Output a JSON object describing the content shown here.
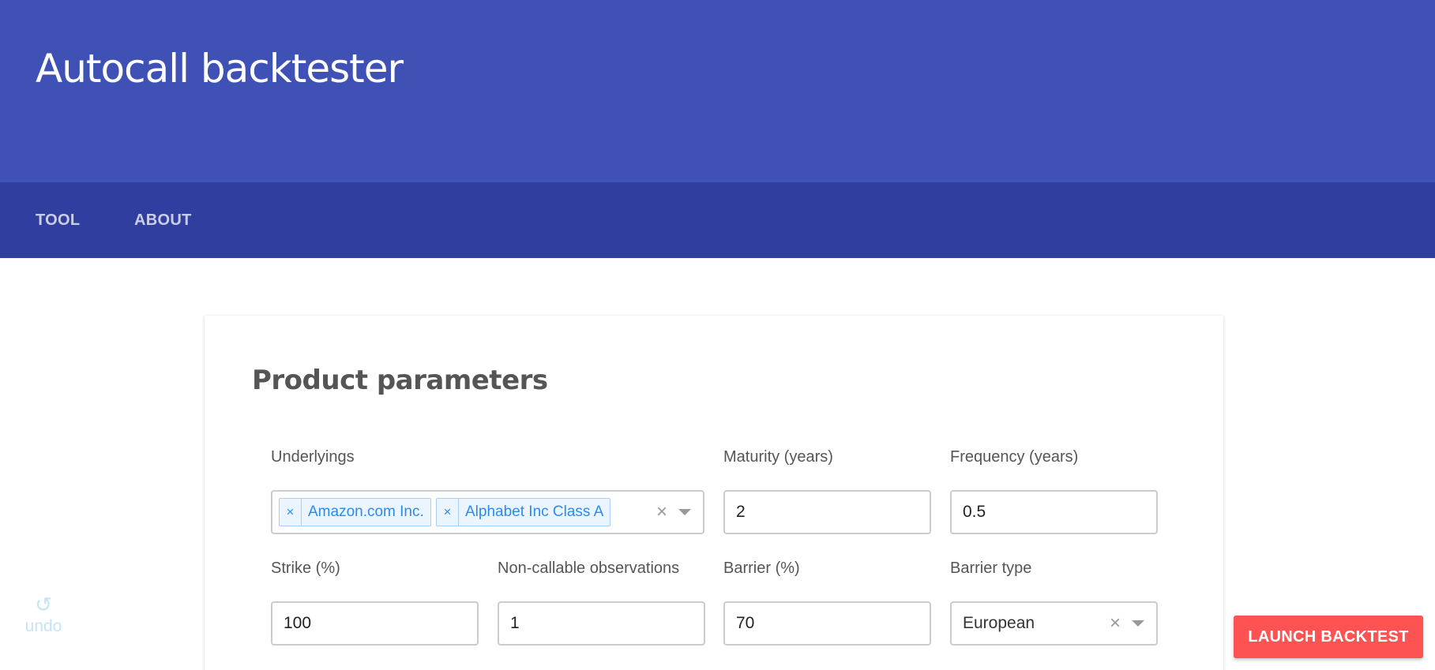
{
  "app": {
    "title": "Autocall backtester"
  },
  "tabs": [
    {
      "label": "TOOL"
    },
    {
      "label": "ABOUT"
    }
  ],
  "card": {
    "title": "Product parameters",
    "fields": {
      "underlyings": {
        "label": "Underlyings",
        "chips": [
          "Amazon.com Inc.",
          "Alphabet Inc Class A"
        ],
        "remove_glyph": "×",
        "clear_glyph": "×"
      },
      "maturity": {
        "label": "Maturity (years)",
        "value": "2"
      },
      "frequency": {
        "label": "Frequency (years)",
        "value": "0.5"
      },
      "strike": {
        "label": "Strike (%)",
        "value": "100"
      },
      "non_callable": {
        "label": "Non-callable observations",
        "value": "1"
      },
      "barrier": {
        "label": "Barrier (%)",
        "value": "70"
      },
      "barrier_type": {
        "label": "Barrier type",
        "value": "European",
        "clear_glyph": "×"
      }
    }
  },
  "undo": {
    "icon": "undo-icon",
    "glyph": "↺",
    "label": "undo"
  },
  "launch": {
    "label": "LAUNCH BACKTEST"
  },
  "colors": {
    "header": "#3f51b5",
    "tabbar": "#303f9f",
    "accent": "#ff5252",
    "chip_text": "#2d8be8"
  }
}
